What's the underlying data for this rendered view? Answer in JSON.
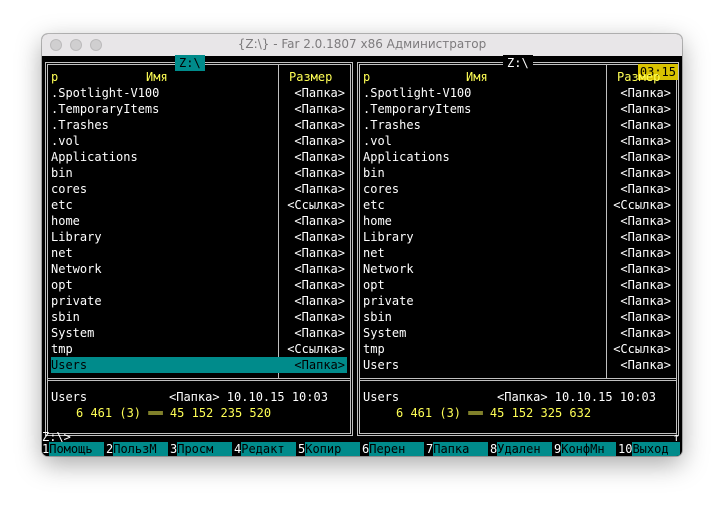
{
  "window": {
    "title": "{Z:\\} - Far 2.0.1807 x86 Администратор"
  },
  "left_panel": {
    "path": " Z:\\ ",
    "col_name": "Имя",
    "col_size": "Размер",
    "col_n": "р",
    "files": [
      {
        "name": ".Spotlight-V100",
        "size": "<Папка>"
      },
      {
        "name": ".TemporaryItems",
        "size": "<Папка>"
      },
      {
        "name": ".Trashes",
        "size": "<Папка>"
      },
      {
        "name": ".vol",
        "size": "<Папка>"
      },
      {
        "name": "Applications",
        "size": "<Папка>"
      },
      {
        "name": "bin",
        "size": "<Папка>"
      },
      {
        "name": "cores",
        "size": "<Папка>"
      },
      {
        "name": "etc",
        "size": "<Ссылка>"
      },
      {
        "name": "home",
        "size": "<Папка>"
      },
      {
        "name": "Library",
        "size": "<Папка>"
      },
      {
        "name": "net",
        "size": "<Папка>"
      },
      {
        "name": "Network",
        "size": "<Папка>"
      },
      {
        "name": "opt",
        "size": "<Папка>"
      },
      {
        "name": "private",
        "size": "<Папка>"
      },
      {
        "name": "sbin",
        "size": "<Папка>"
      },
      {
        "name": "System",
        "size": "<Папка>"
      },
      {
        "name": "tmp",
        "size": "<Ссылка>"
      },
      {
        "name": "Users",
        "size": "<Папка>",
        "selected": true
      }
    ],
    "info_name": "Users",
    "info_detail": "<Папка> 10.10.15 10:03",
    "totals": "6 461 (3) ══ 45 152 235 520"
  },
  "right_panel": {
    "path": " Z:\\ ",
    "clock": "03:15",
    "col_name": "Имя",
    "col_size": "Размер",
    "col_n": "р",
    "files": [
      {
        "name": ".Spotlight-V100",
        "size": "<Папка>"
      },
      {
        "name": ".TemporaryItems",
        "size": "<Папка>"
      },
      {
        "name": ".Trashes",
        "size": "<Папка>"
      },
      {
        "name": ".vol",
        "size": "<Папка>"
      },
      {
        "name": "Applications",
        "size": "<Папка>"
      },
      {
        "name": "bin",
        "size": "<Папка>"
      },
      {
        "name": "cores",
        "size": "<Папка>"
      },
      {
        "name": "etc",
        "size": "<Ссылка>"
      },
      {
        "name": "home",
        "size": "<Папка>"
      },
      {
        "name": "Library",
        "size": "<Папка>"
      },
      {
        "name": "net",
        "size": "<Папка>"
      },
      {
        "name": "Network",
        "size": "<Папка>"
      },
      {
        "name": "opt",
        "size": "<Папка>"
      },
      {
        "name": "private",
        "size": "<Папка>"
      },
      {
        "name": "sbin",
        "size": "<Папка>"
      },
      {
        "name": "System",
        "size": "<Папка>"
      },
      {
        "name": "tmp",
        "size": "<Ссылка>"
      },
      {
        "name": "Users",
        "size": "<Папка>"
      }
    ],
    "info_name": "Users",
    "info_detail": "<Папка> 10.10.15 10:03",
    "totals": "6 461 (3) ══ 45 152 325 632"
  },
  "command_line": {
    "prompt": "Z:\\>",
    "scroll_indicator": "↑"
  },
  "keybar": [
    {
      "num": "1",
      "label": "Помощь"
    },
    {
      "num": "2",
      "label": "ПользМ"
    },
    {
      "num": "3",
      "label": "Просм"
    },
    {
      "num": "4",
      "label": "Редакт"
    },
    {
      "num": "5",
      "label": "Копир"
    },
    {
      "num": "6",
      "label": "Перен"
    },
    {
      "num": "7",
      "label": "Папка"
    },
    {
      "num": "8",
      "label": "Удален"
    },
    {
      "num": "9",
      "label": "КонфМн"
    },
    {
      "num": "10",
      "label": "Выход"
    }
  ],
  "colors": {
    "panel_bg": "#000000",
    "selection": "#008b8b",
    "header_text": "#ffff55",
    "clock_bg": "#d8c200"
  }
}
